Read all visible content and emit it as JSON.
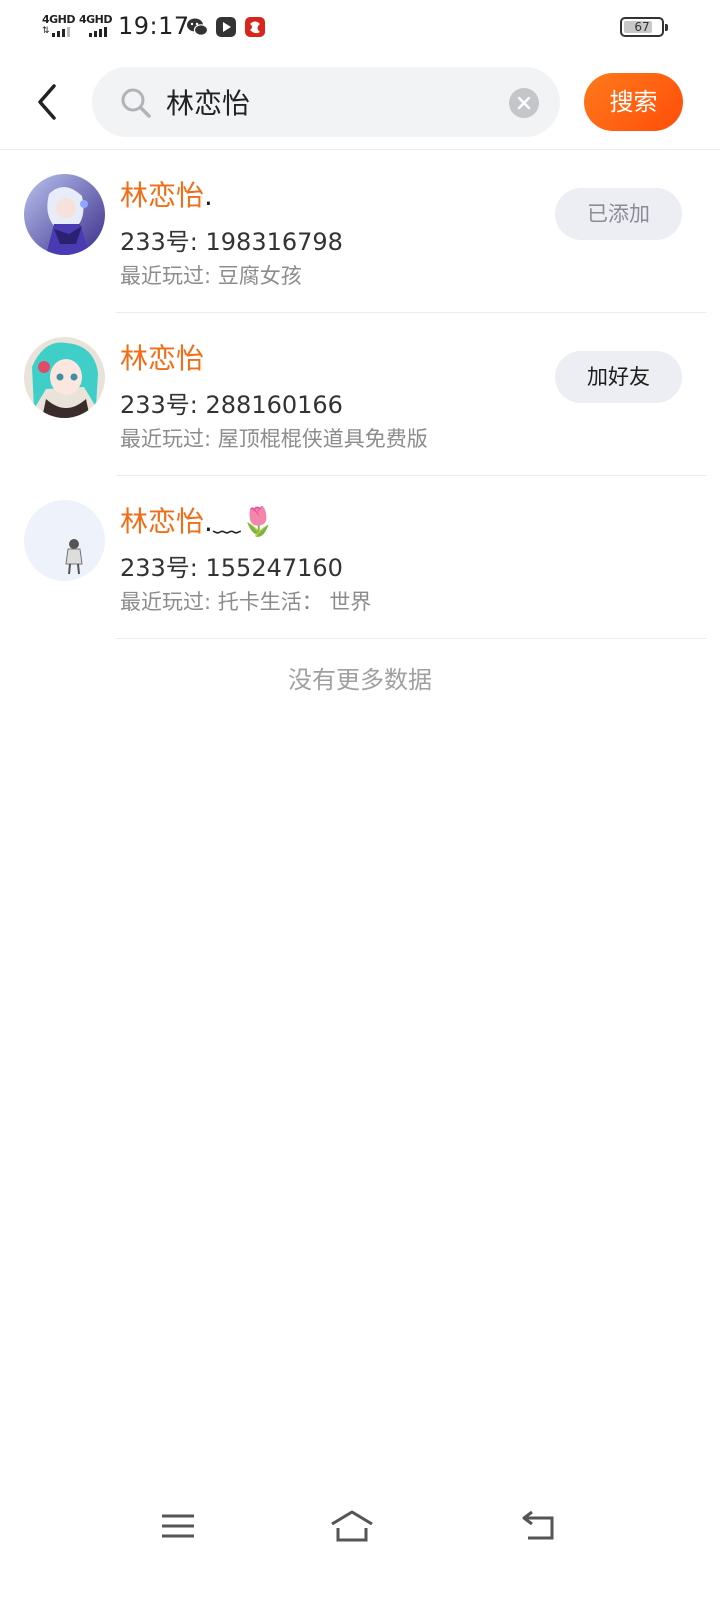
{
  "status_bar": {
    "signal1_label": "4GHD",
    "signal2_label": "4GHD",
    "time": "19:17",
    "icons": [
      "wechat-icon",
      "play-store-icon",
      "red-app-icon"
    ],
    "battery": "67"
  },
  "header": {
    "search_value": "林恋怡",
    "search_button": "搜索"
  },
  "results": [
    {
      "name": "林恋怡",
      "name_suffix": ".",
      "uid": "233号: 198316798",
      "played": "最近玩过: 豆腐女孩",
      "action": "已添加"
    },
    {
      "name": "林恋怡",
      "name_suffix": "",
      "uid": "233号: 288160166",
      "played": "最近玩过: 屋顶棍棍侠道具免费版",
      "action": "加好友"
    },
    {
      "name": "林恋怡",
      "name_suffix": ".﹏🌷",
      "uid": "233号: 155247160",
      "played": "最近玩过: 托卡生活： 世界",
      "action": ""
    }
  ],
  "footer_text": "没有更多数据",
  "nav": [
    "menu-icon",
    "home-icon",
    "back-icon"
  ],
  "colors": {
    "accent": "#f36d16",
    "button": "#ff5a10"
  }
}
